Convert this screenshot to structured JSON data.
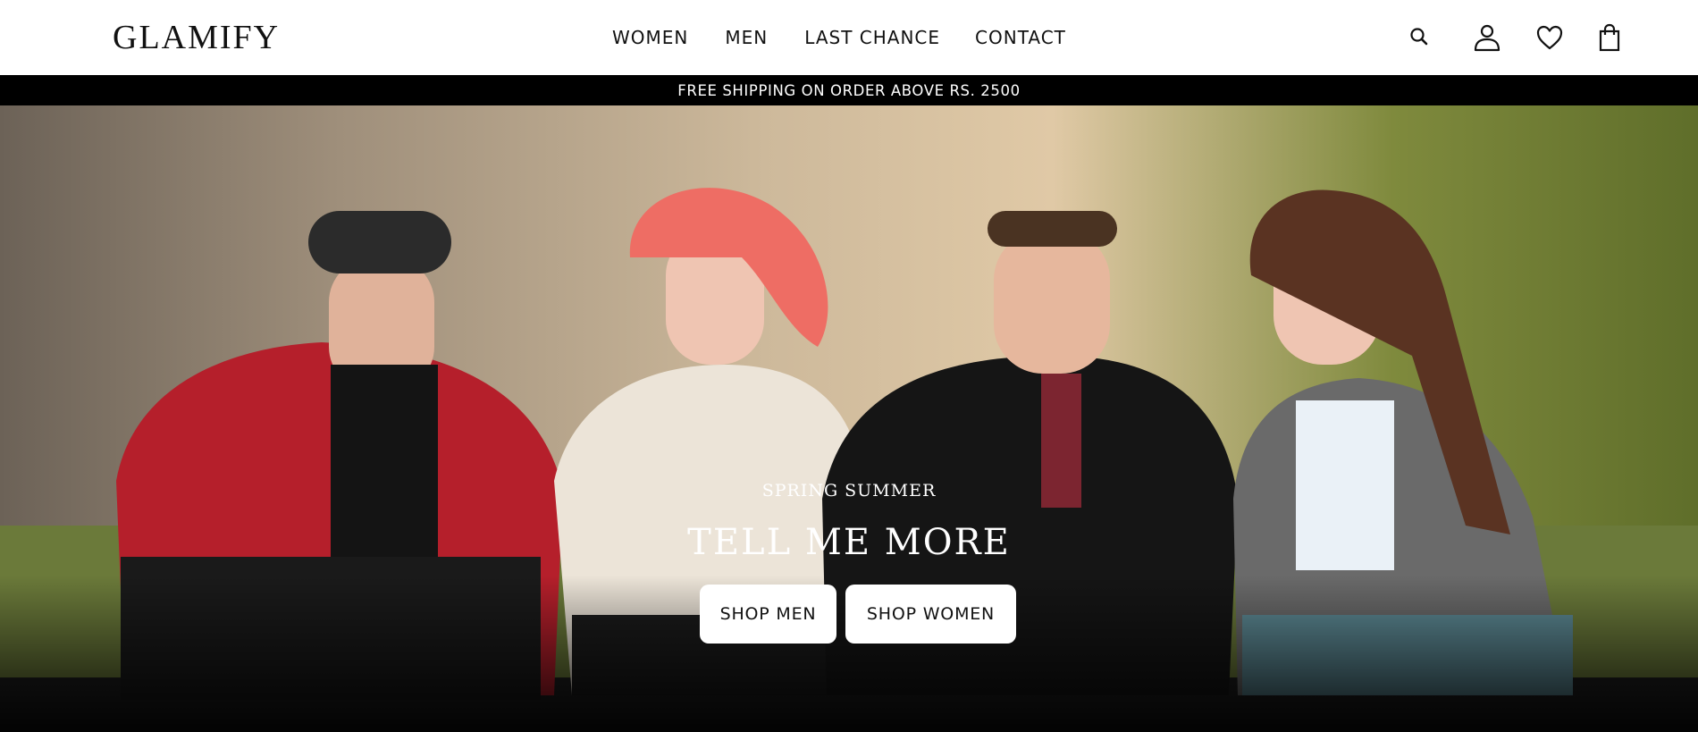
{
  "brand": {
    "logo": "GLAMIFY"
  },
  "nav": {
    "items": [
      {
        "label": "WOMEN"
      },
      {
        "label": "MEN"
      },
      {
        "label": "LAST CHANCE"
      },
      {
        "label": "CONTACT"
      }
    ]
  },
  "header_icons": [
    "search-icon",
    "user-icon",
    "heart-icon",
    "bag-icon"
  ],
  "announcement": {
    "text": "FREE SHIPPING ON ORDER ABOVE RS. 2500"
  },
  "hero": {
    "subtitle": "SPRING SUMMER",
    "title": "TELL ME MORE",
    "buttons": [
      {
        "label": "SHOP MEN"
      },
      {
        "label": "SHOP WOMEN"
      }
    ]
  },
  "colors": {
    "header_bg": "#ffffff",
    "announcement_bg": "#000000",
    "text_dark": "#111111",
    "button_bg": "#ffffff"
  }
}
